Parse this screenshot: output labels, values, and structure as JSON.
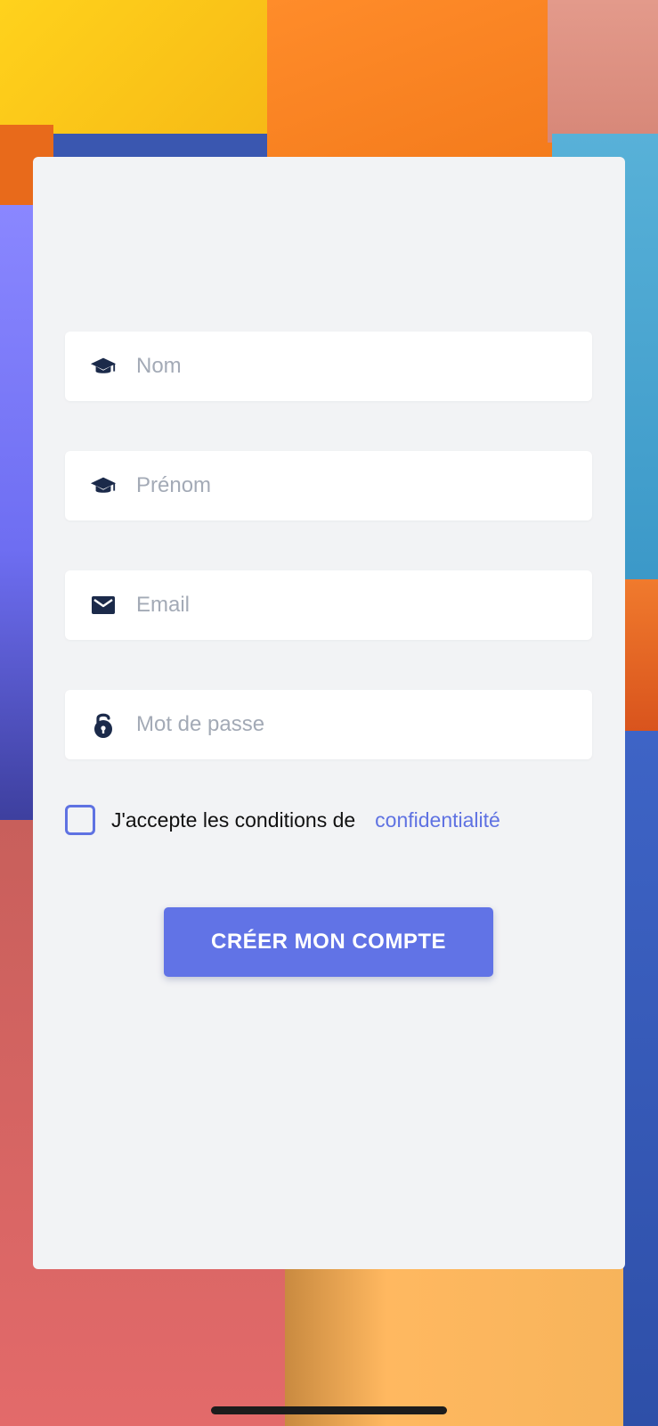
{
  "form": {
    "fields": [
      {
        "name": "nom",
        "placeholder": "Nom",
        "value": "",
        "icon": "graduation-cap-icon"
      },
      {
        "name": "prenom",
        "placeholder": "Prénom",
        "value": "",
        "icon": "graduation-cap-icon"
      },
      {
        "name": "email",
        "placeholder": "Email",
        "value": "",
        "icon": "envelope-icon"
      },
      {
        "name": "password",
        "placeholder": "Mot de passe",
        "value": "",
        "icon": "unlock-icon"
      }
    ],
    "terms": {
      "text": "J'accepte les conditions de",
      "link": "confidentialité",
      "checked": false
    },
    "submit_label": "CRÉER MON COMPTE"
  },
  "colors": {
    "accent": "#6173e6",
    "card_background": "#f2f3f5",
    "icon": "#1b2a4a",
    "placeholder": "#a3aab6"
  }
}
